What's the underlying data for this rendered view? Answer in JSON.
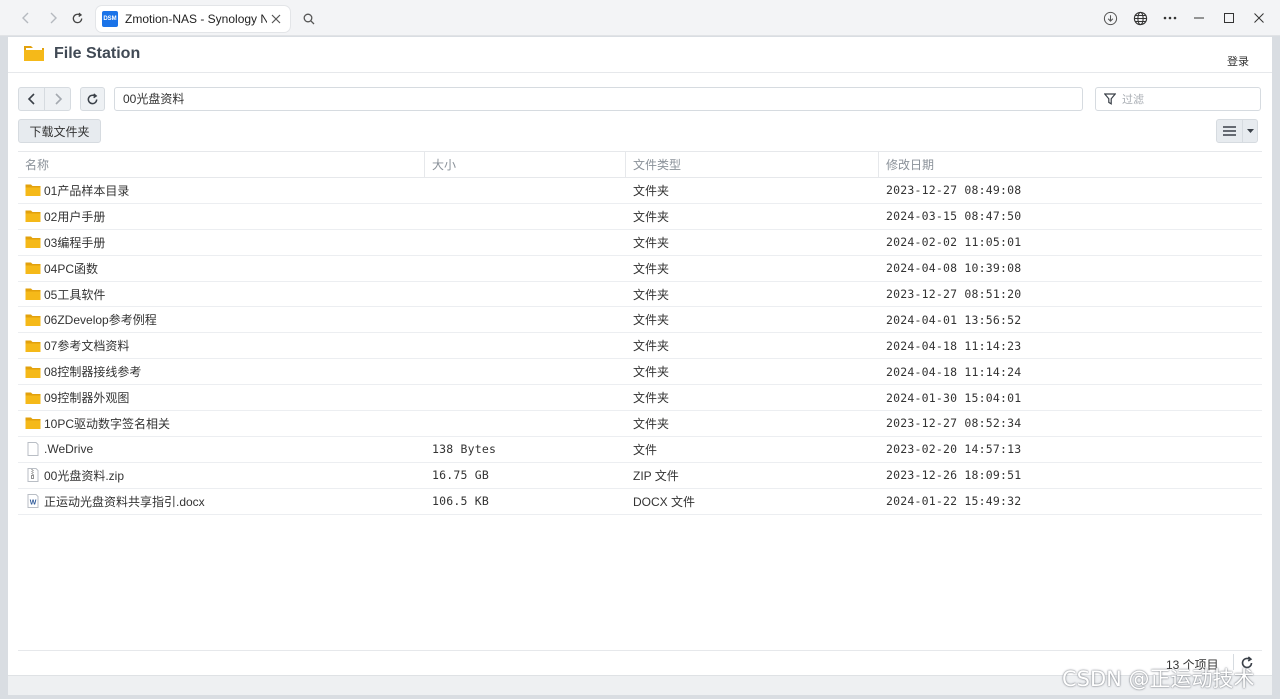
{
  "browser": {
    "tab_title": "Zmotion-NAS - Synology NAS",
    "favicon_label": "DSM",
    "icons": {
      "back": "chevron-left-icon",
      "forward": "chevron-right-icon",
      "reload": "refresh-icon",
      "close_tab": "close-icon",
      "search": "search-icon",
      "download": "download-icon",
      "globe": "globe-icon",
      "more": "more-horizontal-icon",
      "minimize": "minimize-icon",
      "maximize": "maximize-icon",
      "close_window": "close-icon"
    }
  },
  "app": {
    "title": "File Station",
    "login": "登录",
    "path": "00光盘资料",
    "filter_placeholder": "过滤",
    "download_folder": "下载文件夹",
    "columns": [
      "名称",
      "大小",
      "文件类型",
      "修改日期"
    ],
    "rows": [
      {
        "icon": "folder",
        "name": "01产品样本目录",
        "size": "",
        "type": "文件夹",
        "modified": "2023-12-27 08:49:08"
      },
      {
        "icon": "folder",
        "name": "02用户手册",
        "size": "",
        "type": "文件夹",
        "modified": "2024-03-15 08:47:50"
      },
      {
        "icon": "folder",
        "name": "03编程手册",
        "size": "",
        "type": "文件夹",
        "modified": "2024-02-02 11:05:01"
      },
      {
        "icon": "folder",
        "name": "04PC函数",
        "size": "",
        "type": "文件夹",
        "modified": "2024-04-08 10:39:08"
      },
      {
        "icon": "folder",
        "name": "05工具软件",
        "size": "",
        "type": "文件夹",
        "modified": "2023-12-27 08:51:20"
      },
      {
        "icon": "folder",
        "name": "06ZDevelop参考例程",
        "size": "",
        "type": "文件夹",
        "modified": "2024-04-01 13:56:52"
      },
      {
        "icon": "folder",
        "name": "07参考文档资料",
        "size": "",
        "type": "文件夹",
        "modified": "2024-04-18 11:14:23"
      },
      {
        "icon": "folder",
        "name": "08控制器接线参考",
        "size": "",
        "type": "文件夹",
        "modified": "2024-04-18 11:14:24"
      },
      {
        "icon": "folder",
        "name": "09控制器外观图",
        "size": "",
        "type": "文件夹",
        "modified": "2024-01-30 15:04:01"
      },
      {
        "icon": "folder",
        "name": "10PC驱动数字签名相关",
        "size": "",
        "type": "文件夹",
        "modified": "2023-12-27 08:52:34"
      },
      {
        "icon": "file",
        "name": ".WeDrive",
        "size": "138 Bytes",
        "type": "文件",
        "modified": "2023-02-20 14:57:13"
      },
      {
        "icon": "zip",
        "name": "00光盘资料.zip",
        "size": "16.75 GB",
        "type": "ZIP 文件",
        "modified": "2023-12-26 18:09:51"
      },
      {
        "icon": "docx",
        "name": "正运动光盘资料共享指引.docx",
        "size": "106.5 KB",
        "type": "DOCX 文件",
        "modified": "2024-01-22 15:49:32"
      }
    ],
    "item_count": "13 个项目",
    "colors": {
      "folder": "#f5b919",
      "folder_dark": "#e2a10d",
      "accent": "#1a73e8",
      "header_text": "#414a55",
      "muted": "#8a9199"
    }
  },
  "watermark": "CSDN @正运动技术"
}
